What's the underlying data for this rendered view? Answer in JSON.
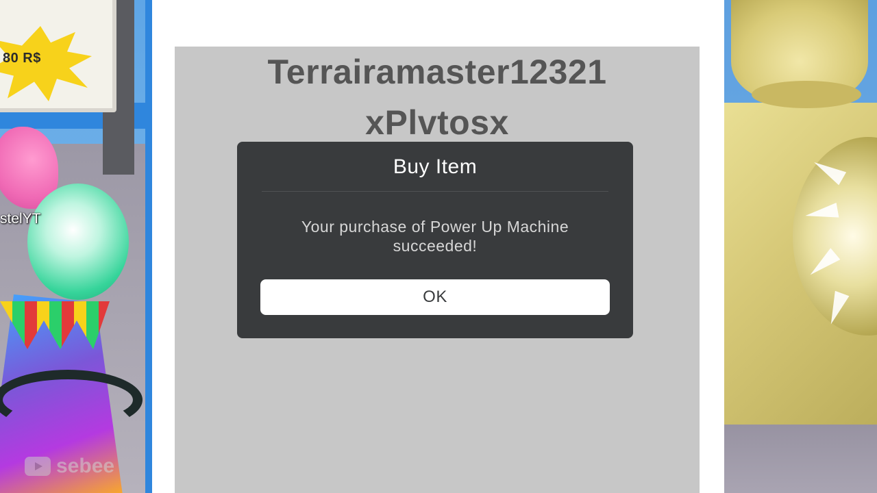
{
  "scene_left": {
    "sign_price": "80 R$",
    "player_name_tag": "stelYT",
    "watermark": "sebee",
    "watermark_icon": "youtube-icon"
  },
  "panel": {
    "username_line1": "Terrairamaster12321",
    "username_line2": "xPlvtosx"
  },
  "dialog": {
    "title": "Buy Item",
    "message": "Your purchase of Power Up Machine succeeded!",
    "ok_label": "OK"
  },
  "colors": {
    "dialog_bg": "#393b3d",
    "card_bg": "#c7c7c7",
    "ok_bg": "#ffffff",
    "accent_blue": "#2f86dd"
  }
}
